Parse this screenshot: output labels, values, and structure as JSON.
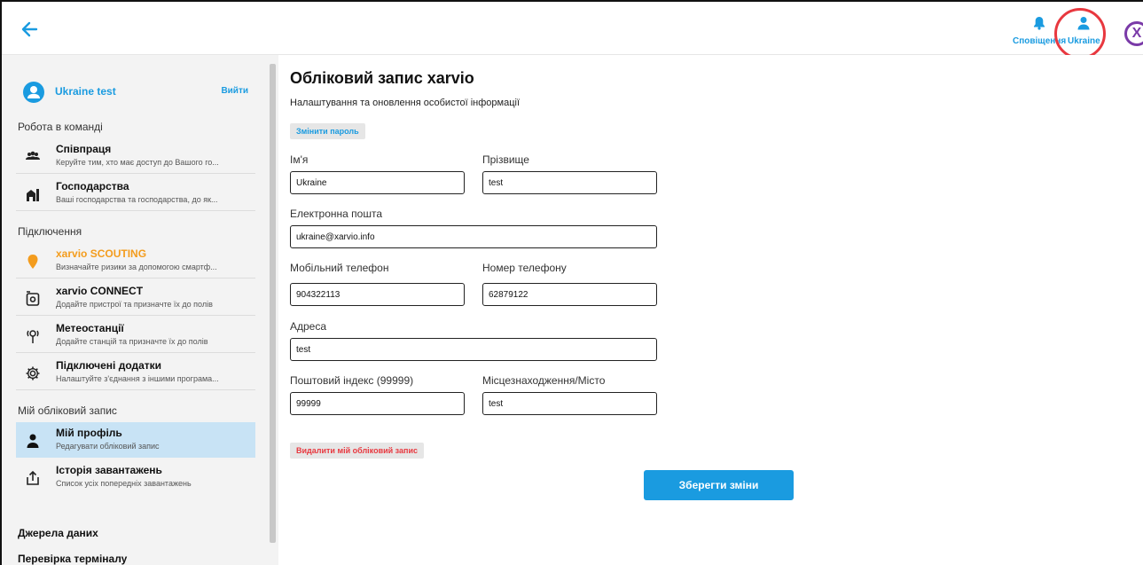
{
  "topbar": {
    "notifications_label": "Сповіщення",
    "user_label": "Ukraine"
  },
  "colors": {
    "accent": "#1a9be0",
    "orange": "#f39c1d",
    "danger": "#e8383f",
    "brand": "#7a3aa8",
    "active_bg": "#c8e3f5"
  },
  "sidebar": {
    "profile_name": "Ukraine test",
    "logout": "Вийти",
    "sections": {
      "team": "Робота в команді",
      "connections": "Підключення",
      "account": "Мій обліковий запис"
    },
    "items": [
      {
        "title": "Співпраця",
        "subtitle": "Керуйте тим, хто має доступ до Вашого го...",
        "icon": "people-icon"
      },
      {
        "title": "Господарства",
        "subtitle": "Ваші господарства та господарства, до як...",
        "icon": "farm-icon"
      },
      {
        "title": "xarvio SCOUTING",
        "subtitle": "Визначайте ризики за допомогою смартф...",
        "icon": "location-pin-icon"
      },
      {
        "title": "xarvio CONNECT",
        "subtitle": "Додайте пристрої та призначте їх до полів",
        "icon": "device-icon"
      },
      {
        "title": "Метеостанції",
        "subtitle": "Додайте станцій та призначте їх до полів",
        "icon": "weather-station-icon"
      },
      {
        "title": "Підключені додатки",
        "subtitle": "Налаштуйте з'єднання з іншими програма...",
        "icon": "gear-icon"
      },
      {
        "title": "Мій профіль",
        "subtitle": "Редагувати обліковий запис",
        "icon": "user-icon"
      },
      {
        "title": "Історія завантажень",
        "subtitle": "Список усіх попередніх завантажень",
        "icon": "upload-icon"
      }
    ],
    "links": {
      "data_sources": "Джерела даних",
      "terminal_check": "Перевірка терміналу"
    }
  },
  "main": {
    "title": "Обліковий запис xarvio",
    "subtitle": "Налаштування та оновлення особистої інформації",
    "change_password": "Змінити пароль",
    "fields": {
      "first_name": {
        "label": "Ім'я",
        "value": "Ukraine"
      },
      "last_name": {
        "label": "Прізвище",
        "value": "test"
      },
      "email": {
        "label": "Електронна пошта",
        "value": "ukraine@xarvio.info"
      },
      "mobile": {
        "label": "Мобільний телефон",
        "value": "904322113"
      },
      "phone": {
        "label": "Номер телефону",
        "value": "62879122"
      },
      "address": {
        "label": "Адреса",
        "value": "test"
      },
      "postal": {
        "label": "Поштовий індекс (99999)",
        "value": "99999"
      },
      "city": {
        "label": "Місцезнаходження/Місто",
        "value": "test"
      }
    },
    "delete_account": "Видалити мій обліковий запис",
    "save": "Зберегти зміни"
  }
}
